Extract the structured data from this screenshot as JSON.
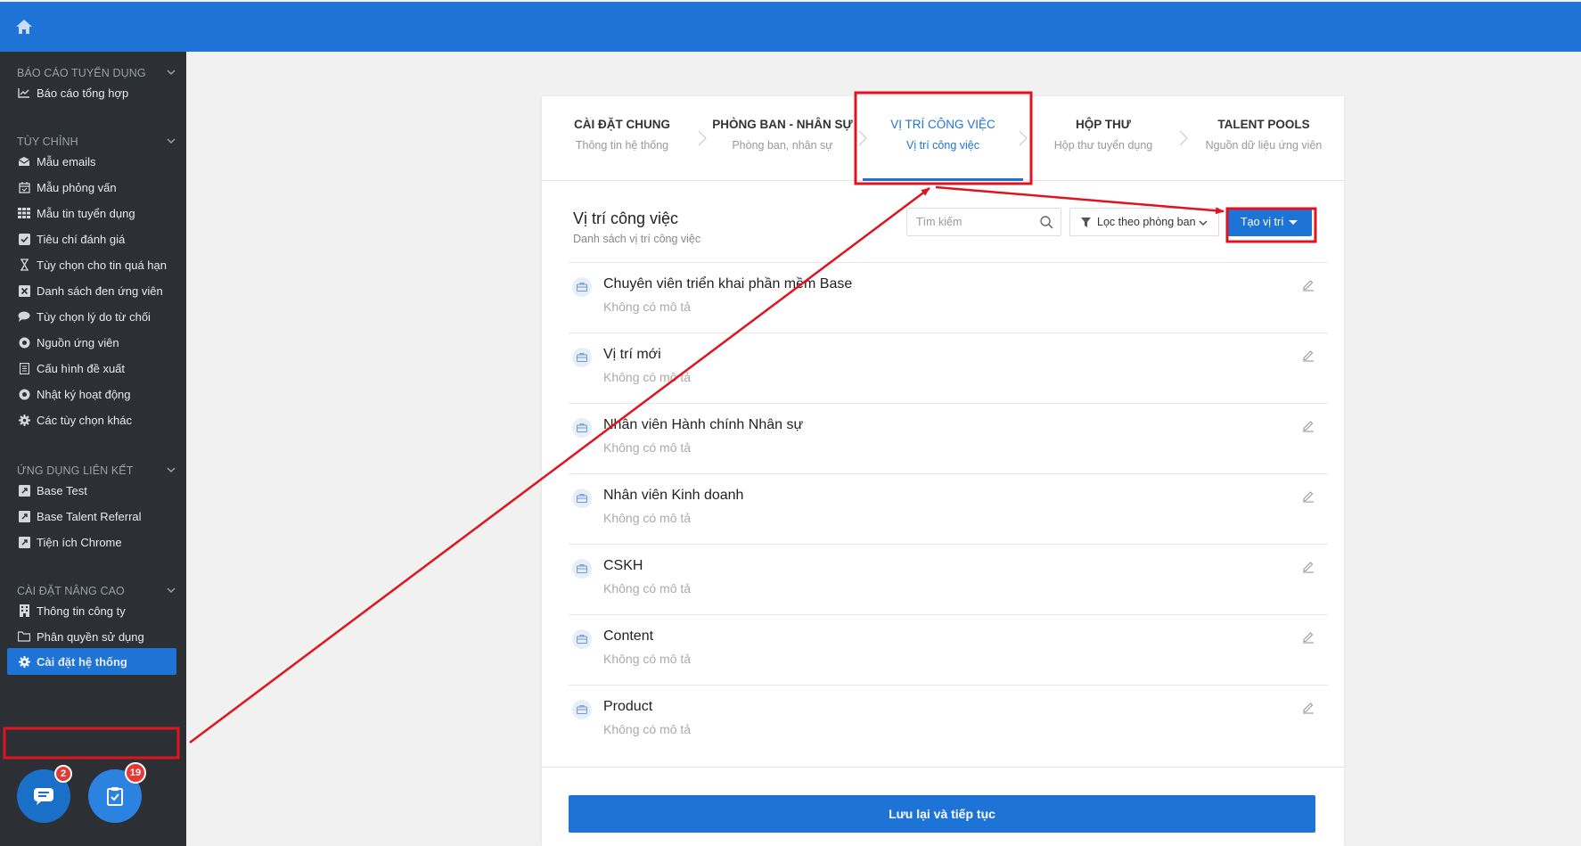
{
  "sidebar": {
    "sections": [
      {
        "title": "BÁO CÁO TUYỂN DỤNG",
        "items": [
          {
            "label": "Báo cáo tổng hợp",
            "icon": "line-chart-icon"
          }
        ]
      },
      {
        "title": "TÙY CHỈNH",
        "items": [
          {
            "label": "Mẫu emails",
            "icon": "envelope-icon"
          },
          {
            "label": "Mẫu phỏng vấn",
            "icon": "calendar-icon"
          },
          {
            "label": "Mẫu tin tuyển dụng",
            "icon": "grid-icon"
          },
          {
            "label": "Tiêu chí đánh giá",
            "icon": "checkbox-icon"
          },
          {
            "label": "Tùy chọn cho tin quá hạn",
            "icon": "hourglass-icon"
          },
          {
            "label": "Danh sách đen ứng viên",
            "icon": "x-box-icon"
          },
          {
            "label": "Tùy chọn lý do từ chối",
            "icon": "comment-icon"
          },
          {
            "label": "Nguồn ứng viên",
            "icon": "eye-icon"
          },
          {
            "label": "Cấu hình đề xuất",
            "icon": "document-icon"
          },
          {
            "label": "Nhật ký hoạt động",
            "icon": "eye-icon"
          },
          {
            "label": "Các tùy chọn khác",
            "icon": "gear-icon"
          }
        ]
      },
      {
        "title": "ỨNG DỤNG LIÊN KẾT",
        "items": [
          {
            "label": "Base Test",
            "icon": "external-link-icon"
          },
          {
            "label": "Base Talent Referral",
            "icon": "external-link-icon"
          },
          {
            "label": "Tiện ích Chrome",
            "icon": "external-link-icon"
          }
        ]
      },
      {
        "title": "CÀI ĐẶT NÂNG CAO",
        "items": [
          {
            "label": "Thông tin công ty",
            "icon": "building-icon"
          },
          {
            "label": "Phân quyền sử dụng",
            "icon": "folder-icon"
          },
          {
            "label": "Cài đặt hệ thống",
            "icon": "gear-icon",
            "active": true
          }
        ]
      }
    ],
    "chat_badge": "2",
    "tasks_badge": "19"
  },
  "steps": [
    {
      "title": "CÀI ĐẶT CHUNG",
      "subtitle": "Thông tin hệ thống"
    },
    {
      "title": "PHÒNG BAN - NHÂN SỰ",
      "subtitle": "Phòng ban, nhân sự"
    },
    {
      "title": "VỊ TRÍ CÔNG VIỆC",
      "subtitle": "Vị trí công việc",
      "active": true
    },
    {
      "title": "HỘP THƯ",
      "subtitle": "Hộp thư tuyển dụng"
    },
    {
      "title": "TALENT POOLS",
      "subtitle": "Nguồn dữ liệu ứng viên"
    }
  ],
  "list": {
    "title": "Vị trí công việc",
    "subtitle": "Danh sách vị trí công việc",
    "search_placeholder": "Tìm kiếm",
    "filter_label": "Lọc theo phòng ban",
    "create_label": "Tạo vị trí",
    "items": [
      {
        "name": "Chuyên viên triển khai phần mềm Base",
        "desc": "Không có mô tả"
      },
      {
        "name": "Vị trí mới",
        "desc": "Không có mô tả"
      },
      {
        "name": "Nhân viên Hành chính Nhân sự",
        "desc": "Không có mô tả"
      },
      {
        "name": "Nhân viên Kinh doanh",
        "desc": "Không có mô tả"
      },
      {
        "name": "CSKH",
        "desc": "Không có mô tả"
      },
      {
        "name": "Content",
        "desc": "Không có mô tả"
      },
      {
        "name": "Product",
        "desc": "Không có mô tả"
      }
    ]
  },
  "save_label": "Lưu lại và tiếp tục",
  "colors": {
    "primary": "#1e73d6",
    "sidebar": "#2c3035",
    "highlight": "#e0141e",
    "badge": "#e53935"
  }
}
